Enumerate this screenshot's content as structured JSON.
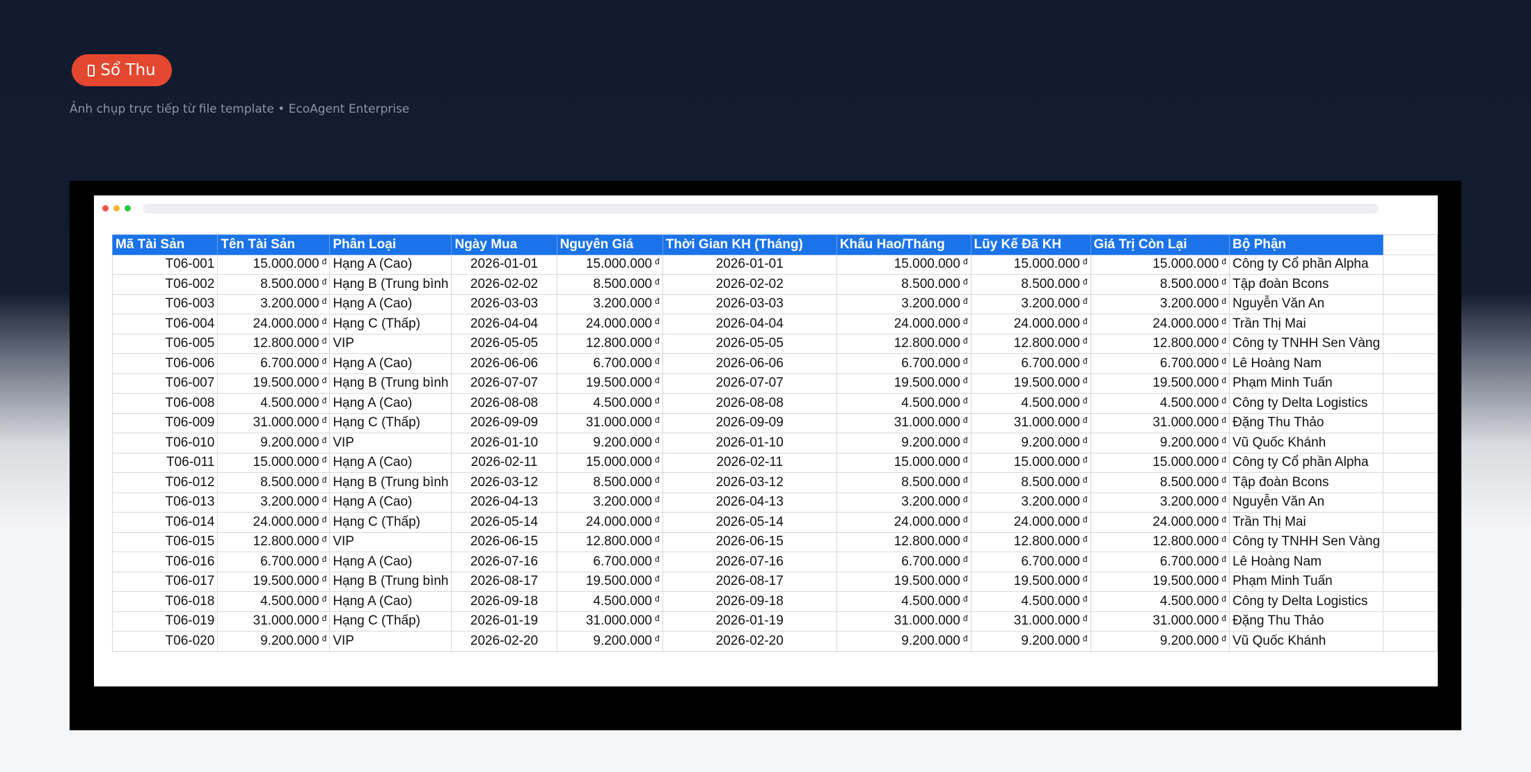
{
  "header": {
    "badge_label": "Sổ Thu",
    "badge_icon": "document-icon",
    "subtitle": "Ảnh chụp trực tiếp từ file template • EcoAgent Enterprise"
  },
  "colors": {
    "accent": "#e4472f",
    "header_bg": "#1a73e8",
    "page_bg": "#111a2e"
  },
  "currency_symbol": "đ",
  "columns": [
    "Mã Tài Sản",
    "Tên Tài Sản",
    "Phân Loại",
    "Ngày Mua",
    "Nguyên Giá",
    "Thời Gian KH (Tháng)",
    "Khấu Hao/Tháng",
    "Lũy Kế Đã KH",
    "Giá Trị Còn Lại",
    "Bộ Phận"
  ],
  "rows": [
    [
      "T06-001",
      "15.000.000",
      "Hạng A (Cao)",
      "2026-01-01",
      "15.000.000",
      "2026-01-01",
      "15.000.000",
      "15.000.000",
      "15.000.000",
      "Công ty Cổ phần Alpha"
    ],
    [
      "T06-002",
      "8.500.000",
      "Hạng B (Trung bình",
      "2026-02-02",
      "8.500.000",
      "2026-02-02",
      "8.500.000",
      "8.500.000",
      "8.500.000",
      "Tập đoàn Bcons"
    ],
    [
      "T06-003",
      "3.200.000",
      "Hạng A (Cao)",
      "2026-03-03",
      "3.200.000",
      "2026-03-03",
      "3.200.000",
      "3.200.000",
      "3.200.000",
      "Nguyễn Văn An"
    ],
    [
      "T06-004",
      "24.000.000",
      "Hạng C (Thấp)",
      "2026-04-04",
      "24.000.000",
      "2026-04-04",
      "24.000.000",
      "24.000.000",
      "24.000.000",
      "Trần Thị Mai"
    ],
    [
      "T06-005",
      "12.800.000",
      "VIP",
      "2026-05-05",
      "12.800.000",
      "2026-05-05",
      "12.800.000",
      "12.800.000",
      "12.800.000",
      "Công ty TNHH Sen Vàng"
    ],
    [
      "T06-006",
      "6.700.000",
      "Hạng A (Cao)",
      "2026-06-06",
      "6.700.000",
      "2026-06-06",
      "6.700.000",
      "6.700.000",
      "6.700.000",
      "Lê Hoàng Nam"
    ],
    [
      "T06-007",
      "19.500.000",
      "Hạng B (Trung bình",
      "2026-07-07",
      "19.500.000",
      "2026-07-07",
      "19.500.000",
      "19.500.000",
      "19.500.000",
      "Phạm Minh Tuấn"
    ],
    [
      "T06-008",
      "4.500.000",
      "Hạng A (Cao)",
      "2026-08-08",
      "4.500.000",
      "2026-08-08",
      "4.500.000",
      "4.500.000",
      "4.500.000",
      "Công ty Delta Logistics"
    ],
    [
      "T06-009",
      "31.000.000",
      "Hạng C (Thấp)",
      "2026-09-09",
      "31.000.000",
      "2026-09-09",
      "31.000.000",
      "31.000.000",
      "31.000.000",
      "Đặng Thu Thảo"
    ],
    [
      "T06-010",
      "9.200.000",
      "VIP",
      "2026-01-10",
      "9.200.000",
      "2026-01-10",
      "9.200.000",
      "9.200.000",
      "9.200.000",
      "Vũ Quốc Khánh"
    ],
    [
      "T06-011",
      "15.000.000",
      "Hạng A (Cao)",
      "2026-02-11",
      "15.000.000",
      "2026-02-11",
      "15.000.000",
      "15.000.000",
      "15.000.000",
      "Công ty Cổ phần Alpha"
    ],
    [
      "T06-012",
      "8.500.000",
      "Hạng B (Trung bình",
      "2026-03-12",
      "8.500.000",
      "2026-03-12",
      "8.500.000",
      "8.500.000",
      "8.500.000",
      "Tập đoàn Bcons"
    ],
    [
      "T06-013",
      "3.200.000",
      "Hạng A (Cao)",
      "2026-04-13",
      "3.200.000",
      "2026-04-13",
      "3.200.000",
      "3.200.000",
      "3.200.000",
      "Nguyễn Văn An"
    ],
    [
      "T06-014",
      "24.000.000",
      "Hạng C (Thấp)",
      "2026-05-14",
      "24.000.000",
      "2026-05-14",
      "24.000.000",
      "24.000.000",
      "24.000.000",
      "Trần Thị Mai"
    ],
    [
      "T06-015",
      "12.800.000",
      "VIP",
      "2026-06-15",
      "12.800.000",
      "2026-06-15",
      "12.800.000",
      "12.800.000",
      "12.800.000",
      "Công ty TNHH Sen Vàng"
    ],
    [
      "T06-016",
      "6.700.000",
      "Hạng A (Cao)",
      "2026-07-16",
      "6.700.000",
      "2026-07-16",
      "6.700.000",
      "6.700.000",
      "6.700.000",
      "Lê Hoàng Nam"
    ],
    [
      "T06-017",
      "19.500.000",
      "Hạng B (Trung bình",
      "2026-08-17",
      "19.500.000",
      "2026-08-17",
      "19.500.000",
      "19.500.000",
      "19.500.000",
      "Phạm Minh Tuấn"
    ],
    [
      "T06-018",
      "4.500.000",
      "Hạng A (Cao)",
      "2026-09-18",
      "4.500.000",
      "2026-09-18",
      "4.500.000",
      "4.500.000",
      "4.500.000",
      "Công ty Delta Logistics"
    ],
    [
      "T06-019",
      "31.000.000",
      "Hạng C (Thấp)",
      "2026-01-19",
      "31.000.000",
      "2026-01-19",
      "31.000.000",
      "31.000.000",
      "31.000.000",
      "Đặng Thu Thảo"
    ],
    [
      "T06-020",
      "9.200.000",
      "VIP",
      "2026-02-20",
      "9.200.000",
      "2026-02-20",
      "9.200.000",
      "9.200.000",
      "9.200.000",
      "Vũ Quốc Khánh"
    ]
  ]
}
